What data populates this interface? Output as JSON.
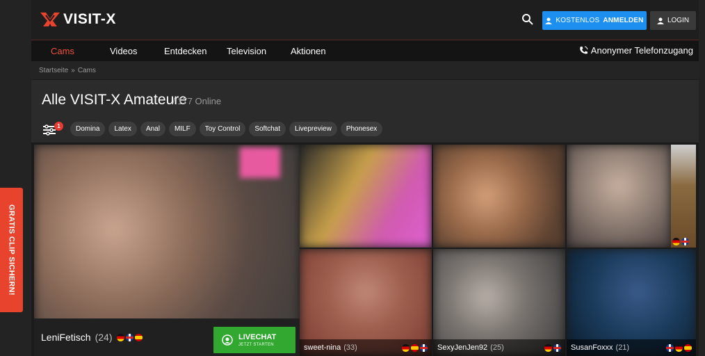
{
  "brand": {
    "name": "VISIT-X",
    "accent": "#f0513c"
  },
  "header": {
    "register_prefix": "KOSTENLOS",
    "register_label": "ANMELDEN",
    "login_label": "LOGIN",
    "register_color": "#1d8ff0"
  },
  "nav": {
    "items": [
      {
        "label": "Cams",
        "active": true
      },
      {
        "label": "Videos"
      },
      {
        "label": "Entdecken"
      },
      {
        "label": "Television"
      },
      {
        "label": "Aktionen"
      }
    ],
    "phone_label": "Anonymer Telefonzugang"
  },
  "breadcrumb": {
    "home": "Startseite",
    "separator": "»",
    "current": "Cams"
  },
  "page": {
    "title": "Alle VISIT-X Amateure",
    "online": "/ 177 Online",
    "filter_badge": "1"
  },
  "chips": [
    "Domina",
    "Latex",
    "Anal",
    "MILF",
    "Toy Control",
    "Softchat",
    "Livepreview",
    "Phonesex"
  ],
  "side_tab": {
    "label": "GRATIS CLIP SICHERN!"
  },
  "featured": {
    "name": "LeniFetisch",
    "age": "(24)",
    "flags": [
      "de",
      "gb",
      "es"
    ],
    "livechat_label": "LIVECHAT",
    "livechat_sub": "JETZT STARTEN"
  },
  "tiles": [
    {
      "name": "sweet-nina",
      "age": "(33)",
      "flags": [
        "de",
        "es",
        "gb"
      ]
    },
    {
      "name": "SexyJenJen92",
      "age": "(25)",
      "flags": [
        "de",
        "gb"
      ]
    },
    {
      "name": "SusanFoxxx",
      "age": "(21)",
      "flags": [
        "gb",
        "de",
        "es"
      ]
    }
  ]
}
